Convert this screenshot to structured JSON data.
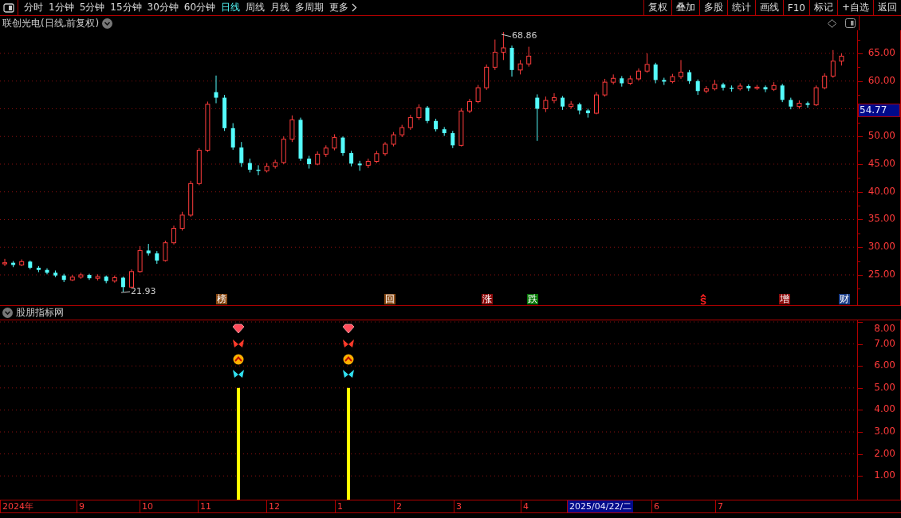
{
  "toolbar": {
    "periods": [
      {
        "label": "分时",
        "selected": false
      },
      {
        "label": "1分钟",
        "selected": false
      },
      {
        "label": "5分钟",
        "selected": false
      },
      {
        "label": "15分钟",
        "selected": false
      },
      {
        "label": "30分钟",
        "selected": false
      },
      {
        "label": "60分钟",
        "selected": false
      },
      {
        "label": "日线",
        "selected": true
      },
      {
        "label": "周线",
        "selected": false
      },
      {
        "label": "月线",
        "selected": false
      },
      {
        "label": "多周期",
        "selected": false
      }
    ],
    "more": "更多",
    "buttons": [
      "复权",
      "叠加",
      "多股",
      "统计",
      "画线",
      "F10",
      "标记",
      "+自选",
      "返回"
    ]
  },
  "chart_header": {
    "title": "联创光电(日线,前复权)"
  },
  "price_chart": {
    "high_label": "68.86",
    "low_label": "21.93",
    "current_price": "54.77",
    "chart_data": {
      "type": "candlestick",
      "ylim": [
        19.53,
        69.17
      ],
      "grid": true,
      "yticks": [
        {
          "value": 65,
          "label": "65.00"
        },
        {
          "value": 60,
          "label": "60.00"
        },
        {
          "value": 50,
          "label": "50.00"
        },
        {
          "value": 45,
          "label": "45.00"
        },
        {
          "value": 40,
          "label": "40.00"
        },
        {
          "value": 35,
          "label": "35.00"
        },
        {
          "value": 30,
          "label": "30.00"
        },
        {
          "value": 25,
          "label": "25.00"
        }
      ],
      "ohlc": [
        [
          27.0,
          27.9,
          26.6,
          27.2
        ],
        [
          27.2,
          27.5,
          26.4,
          26.8
        ],
        [
          26.8,
          27.8,
          26.6,
          27.4
        ],
        [
          27.4,
          27.6,
          26.0,
          26.3
        ],
        [
          26.3,
          26.6,
          25.5,
          25.9
        ],
        [
          25.9,
          26.2,
          25.1,
          25.4
        ],
        [
          25.4,
          25.8,
          24.6,
          24.9
        ],
        [
          24.9,
          25.2,
          23.7,
          24.1
        ],
        [
          24.1,
          25.0,
          23.9,
          24.6
        ],
        [
          24.6,
          25.4,
          24.3,
          25.0
        ],
        [
          25.0,
          25.2,
          24.1,
          24.4
        ],
        [
          24.4,
          25.1,
          24.0,
          24.7
        ],
        [
          24.7,
          24.9,
          23.5,
          23.9
        ],
        [
          23.9,
          24.9,
          23.6,
          24.5
        ],
        [
          24.5,
          24.7,
          21.93,
          22.8
        ],
        [
          22.8,
          26.0,
          22.6,
          25.6
        ],
        [
          25.6,
          30.2,
          25.4,
          29.4
        ],
        [
          29.4,
          30.6,
          28.5,
          28.9
        ],
        [
          28.9,
          29.3,
          27.0,
          27.6
        ],
        [
          27.6,
          31.2,
          27.4,
          30.8
        ],
        [
          30.8,
          33.9,
          30.5,
          33.4
        ],
        [
          33.4,
          36.4,
          33.0,
          35.8
        ],
        [
          35.8,
          42.0,
          35.5,
          41.5
        ],
        [
          41.5,
          47.9,
          41.2,
          47.5
        ],
        [
          47.5,
          56.3,
          47.2,
          55.8
        ],
        [
          58.0,
          61.0,
          56.0,
          57.0
        ],
        [
          57.0,
          57.5,
          51.0,
          51.5
        ],
        [
          51.5,
          52.4,
          47.6,
          48.0
        ],
        [
          48.0,
          49.0,
          44.5,
          45.2
        ],
        [
          45.2,
          46.0,
          43.5,
          44.0
        ],
        [
          44.0,
          44.8,
          43.0,
          43.8
        ],
        [
          43.8,
          45.2,
          43.5,
          44.6
        ],
        [
          44.6,
          45.8,
          44.2,
          45.3
        ],
        [
          45.3,
          50.0,
          45.0,
          49.5
        ],
        [
          49.5,
          53.8,
          49.0,
          53.0
        ],
        [
          53.0,
          53.4,
          45.6,
          46.0
        ],
        [
          46.0,
          46.5,
          44.2,
          45.0
        ],
        [
          45.0,
          47.3,
          44.8,
          46.8
        ],
        [
          46.8,
          48.4,
          46.3,
          47.9
        ],
        [
          47.9,
          50.4,
          47.5,
          49.8
        ],
        [
          49.8,
          50.0,
          46.5,
          47.0
        ],
        [
          47.0,
          47.4,
          44.6,
          45.1
        ],
        [
          45.1,
          45.6,
          43.8,
          44.8
        ],
        [
          44.8,
          46.0,
          44.3,
          45.5
        ],
        [
          45.5,
          47.4,
          45.2,
          46.9
        ],
        [
          46.9,
          49.0,
          46.5,
          48.6
        ],
        [
          48.6,
          50.8,
          48.2,
          50.3
        ],
        [
          50.3,
          52.1,
          49.9,
          51.6
        ],
        [
          51.6,
          53.9,
          51.2,
          53.4
        ],
        [
          53.4,
          55.8,
          53.0,
          55.2
        ],
        [
          55.2,
          55.5,
          52.4,
          52.8
        ],
        [
          52.8,
          53.2,
          50.9,
          51.3
        ],
        [
          51.3,
          51.7,
          50.1,
          50.6
        ],
        [
          50.6,
          51.0,
          47.9,
          48.4
        ],
        [
          48.4,
          55.1,
          48.2,
          54.6
        ],
        [
          54.6,
          56.8,
          54.2,
          56.3
        ],
        [
          56.3,
          59.3,
          56.0,
          58.8
        ],
        [
          58.8,
          63.0,
          58.4,
          62.5
        ],
        [
          62.5,
          67.5,
          62.0,
          65.2
        ],
        [
          65.2,
          68.86,
          63.8,
          66.0
        ],
        [
          66.0,
          66.4,
          60.8,
          62.0
        ],
        [
          62.0,
          63.8,
          61.2,
          63.1
        ],
        [
          63.1,
          66.2,
          62.6,
          64.5
        ],
        [
          57.0,
          57.6,
          49.2,
          55.0
        ],
        [
          55.0,
          57.2,
          54.4,
          56.5
        ],
        [
          56.5,
          57.8,
          56.0,
          57.0
        ],
        [
          57.0,
          57.3,
          54.8,
          55.4
        ],
        [
          55.4,
          56.4,
          55.0,
          55.8
        ],
        [
          55.8,
          56.1,
          54.0,
          54.7
        ],
        [
          54.7,
          55.0,
          53.4,
          54.2
        ],
        [
          54.2,
          58.0,
          54.0,
          57.5
        ],
        [
          57.5,
          60.4,
          57.2,
          59.8
        ],
        [
          59.8,
          61.2,
          59.4,
          60.5
        ],
        [
          60.5,
          60.9,
          59.0,
          59.6
        ],
        [
          59.6,
          61.0,
          59.3,
          60.4
        ],
        [
          60.4,
          62.3,
          60.1,
          61.8
        ],
        [
          61.8,
          65.0,
          61.5,
          63.0
        ],
        [
          63.0,
          63.3,
          59.6,
          60.2
        ],
        [
          60.2,
          60.6,
          59.3,
          59.9
        ],
        [
          59.9,
          61.3,
          59.6,
          60.8
        ],
        [
          60.8,
          63.8,
          60.4,
          61.6
        ],
        [
          61.6,
          62.0,
          59.5,
          60.0
        ],
        [
          60.0,
          60.3,
          57.5,
          58.2
        ],
        [
          58.2,
          59.1,
          57.8,
          58.6
        ],
        [
          58.6,
          60.2,
          58.3,
          59.4
        ],
        [
          59.4,
          59.7,
          58.3,
          58.8
        ],
        [
          58.8,
          59.2,
          58.1,
          58.6
        ],
        [
          58.6,
          59.6,
          58.3,
          59.1
        ],
        [
          59.1,
          59.4,
          58.2,
          58.7
        ],
        [
          58.7,
          59.3,
          58.4,
          58.9
        ],
        [
          58.9,
          59.2,
          58.0,
          58.5
        ],
        [
          58.5,
          59.8,
          58.2,
          59.2
        ],
        [
          59.2,
          59.5,
          56.2,
          56.6
        ],
        [
          56.6,
          57.0,
          54.9,
          55.4
        ],
        [
          55.4,
          56.5,
          55.0,
          56.0
        ],
        [
          56.0,
          56.3,
          55.2,
          55.7
        ],
        [
          55.7,
          59.2,
          55.5,
          58.8
        ],
        [
          58.8,
          61.4,
          58.5,
          60.9
        ],
        [
          60.9,
          65.6,
          60.6,
          63.6
        ],
        [
          63.6,
          65.0,
          62.8,
          64.5
        ]
      ]
    },
    "events": [
      {
        "kind": "text",
        "label": "榜",
        "color": "#8a4a14"
      },
      {
        "kind": "text",
        "label": "回",
        "color": "#8a4a14"
      },
      {
        "kind": "text",
        "label": "涨",
        "color": "#8b0a0a"
      },
      {
        "kind": "text",
        "label": "跌",
        "color": "#0a7a0a"
      },
      {
        "kind": "icon",
        "color": "#ff2020"
      },
      {
        "kind": "text",
        "label": "增",
        "color": "#8b0a0a"
      },
      {
        "kind": "text",
        "label": "财",
        "color": "#1c3f8a"
      }
    ]
  },
  "indicator": {
    "title": "股朋指标网",
    "yticks": [
      "8.00",
      "7.00",
      "6.00",
      "5.00",
      "4.00",
      "3.00",
      "2.00",
      "1.00"
    ],
    "signals": [
      {
        "kind": "signal"
      },
      {
        "kind": "signal"
      }
    ]
  },
  "date_axis": {
    "labels": [
      {
        "label": "2024年",
        "selected": false
      },
      {
        "label": "9",
        "selected": false
      },
      {
        "label": "10",
        "selected": false
      },
      {
        "label": "11",
        "selected": false
      },
      {
        "label": "12",
        "selected": false
      },
      {
        "label": "1",
        "selected": false
      },
      {
        "label": "2",
        "selected": false
      },
      {
        "label": "3",
        "selected": false
      },
      {
        "label": "4",
        "selected": false
      },
      {
        "label": "2025/04/22/二",
        "selected": true
      },
      {
        "label": "6",
        "selected": false
      },
      {
        "label": "7",
        "selected": false
      }
    ]
  }
}
